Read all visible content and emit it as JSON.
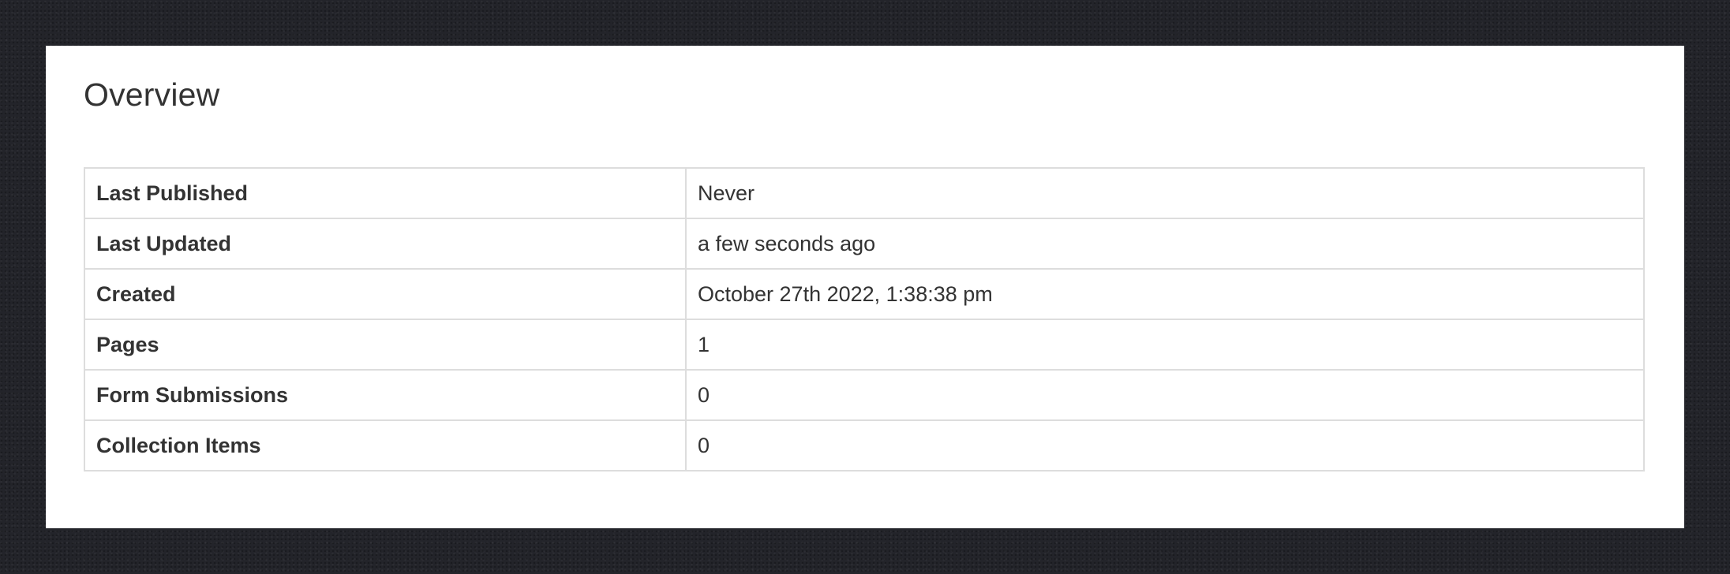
{
  "overview": {
    "title": "Overview",
    "rows": [
      {
        "label": "Last Published",
        "value": "Never"
      },
      {
        "label": "Last Updated",
        "value": "a few seconds ago"
      },
      {
        "label": "Created",
        "value": "October 27th 2022, 1:38:38 pm"
      },
      {
        "label": "Pages",
        "value": "1"
      },
      {
        "label": "Form Submissions",
        "value": "0"
      },
      {
        "label": "Collection Items",
        "value": "0"
      }
    ]
  },
  "colors": {
    "page_background": "#23242a",
    "card_background": "#ffffff",
    "text": "#333333",
    "border": "#dddddd"
  }
}
